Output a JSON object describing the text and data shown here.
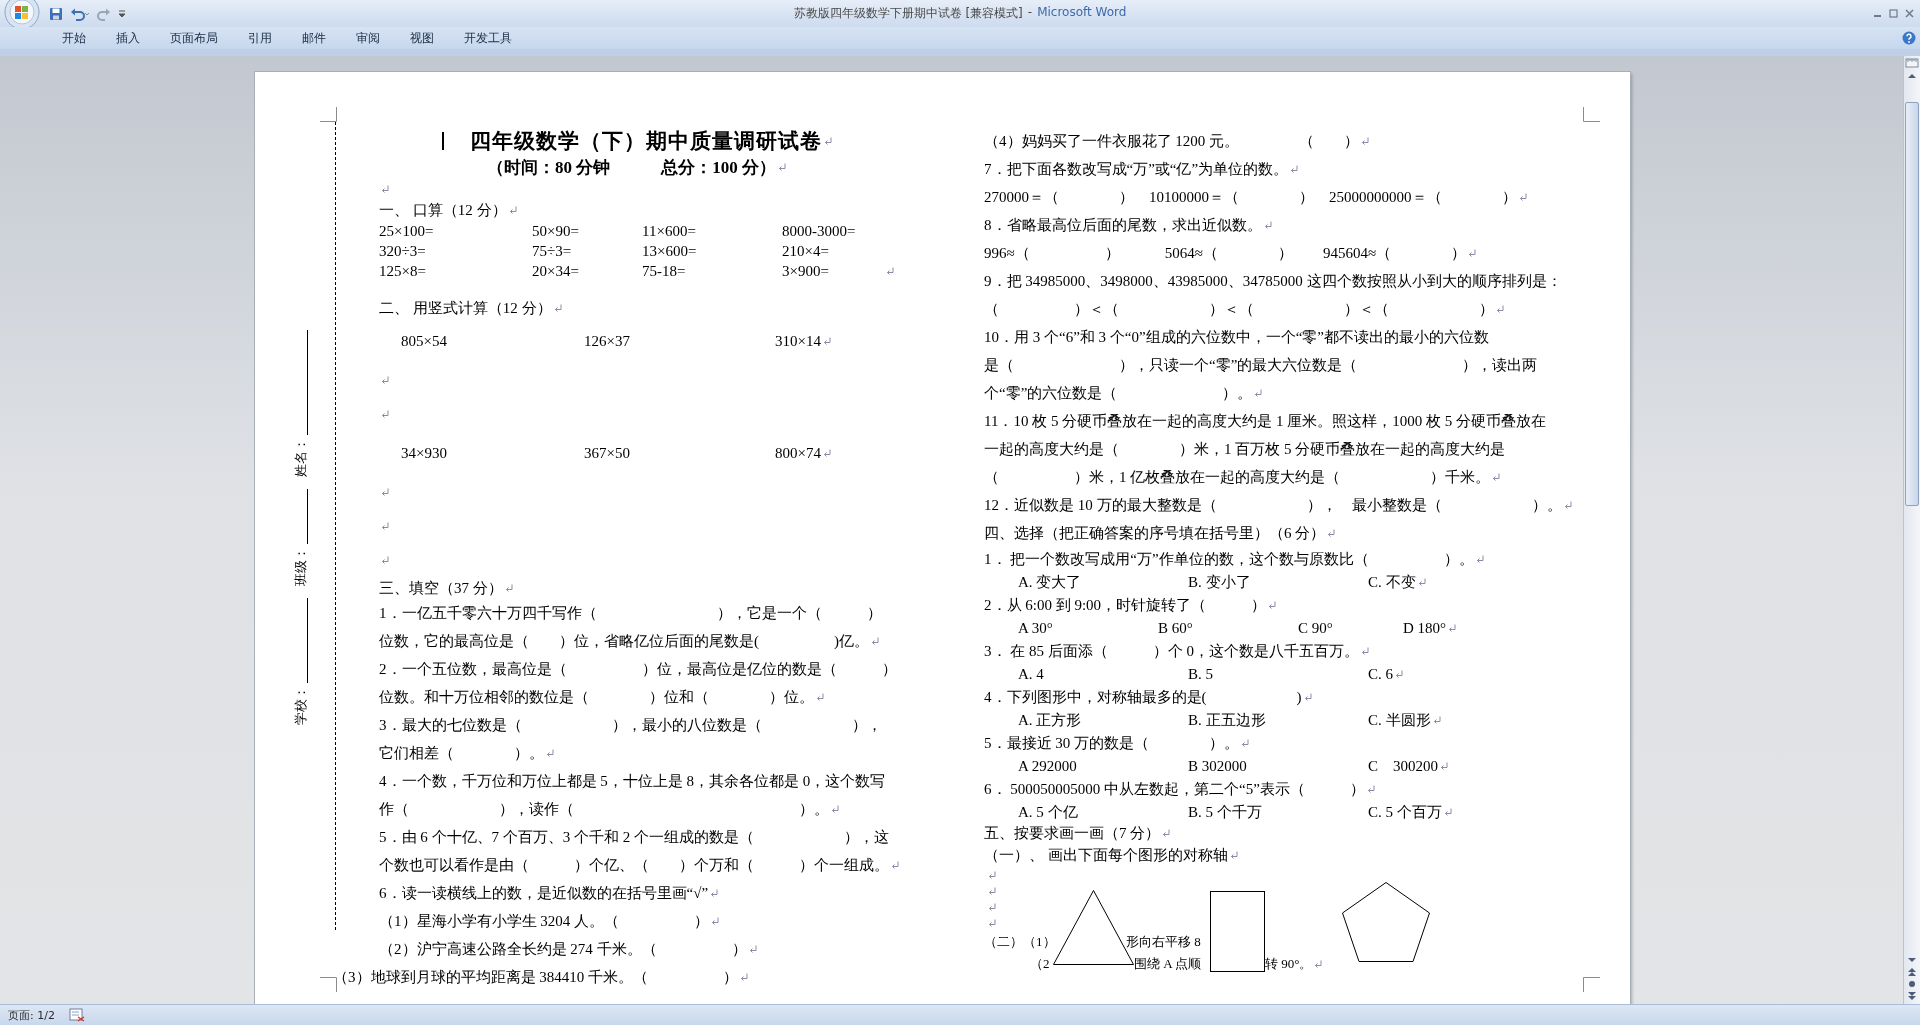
{
  "window": {
    "title": {
      "document": "苏教版四年级数学下册期中试卷 [兼容模式]",
      "separator": "-",
      "app": "Microsoft Word"
    }
  },
  "ribbon": {
    "tabs": [
      {
        "label": "开始",
        "selected": false
      },
      {
        "label": "插入",
        "selected": false
      },
      {
        "label": "页面布局",
        "selected": false
      },
      {
        "label": "引用",
        "selected": false
      },
      {
        "label": "邮件",
        "selected": false
      },
      {
        "label": "审阅",
        "selected": false
      },
      {
        "label": "视图",
        "selected": false
      },
      {
        "label": "开发工具",
        "selected": false
      }
    ]
  },
  "document": {
    "binding_margin": [
      {
        "label": "姓名："
      },
      {
        "label": "班级："
      },
      {
        "label": "学校："
      }
    ],
    "left_column": [
      {
        "kind": "title",
        "text": "四年级数学（下）期中质量调研试卷",
        "end": true
      },
      {
        "kind": "subtitle",
        "text": "（时间：80 分钟　　　总分：100 分）",
        "end": true
      },
      {
        "kind": "blank"
      },
      {
        "kind": "heading",
        "text": "一、 口算（12 分）",
        "end": true
      },
      {
        "kind": "tabs",
        "cells": [
          "25×100=",
          "50×90=",
          "11×600=",
          "8000-3000="
        ],
        "end": false
      },
      {
        "kind": "tabs",
        "cells": [
          "320÷3=",
          "75÷3=",
          "13×600=",
          "210×4="
        ],
        "end": false
      },
      {
        "kind": "tabs",
        "cells": [
          "125×8=",
          "20×34=",
          "75-18=",
          "3×900="
        ],
        "end": true
      },
      {
        "kind": "heading",
        "text": "二、 用竖式计算（12 分）",
        "end": true
      },
      {
        "kind": "calc",
        "cells": [
          "805×54",
          "126×37",
          "310×14"
        ],
        "end": true
      },
      {
        "kind": "blank"
      },
      {
        "kind": "blank"
      },
      {
        "kind": "calc",
        "cells": [
          "34×930",
          "367×50",
          "800×74"
        ],
        "end": true
      },
      {
        "kind": "blank"
      },
      {
        "kind": "blank"
      },
      {
        "kind": "blank"
      },
      {
        "kind": "heading",
        "text": "三、填空（37 分）",
        "end": true
      },
      {
        "kind": "text",
        "text": "1．一亿五千零六十万四千写作（　　　　　　　　），它是一个（　　　）",
        "end": false
      },
      {
        "kind": "text",
        "text": "位数，它的最高位是（　　）位，省略亿位后面的尾数是(　　　　　)亿。",
        "end": true
      },
      {
        "kind": "text",
        "text": "2．一个五位数，最高位是（　　　　　）位，最高位是亿位的数是（　　　）",
        "end": false
      },
      {
        "kind": "text",
        "text": "位数。和十万位相邻的数位是（　　　　）位和（　　　　）位。",
        "end": true
      },
      {
        "kind": "text",
        "text": "3．最大的七位数是（　　　　　　），最小的八位数是（　　　　　　），",
        "end": false
      },
      {
        "kind": "text",
        "text": "它们相差（　　　　）。",
        "end": true
      },
      {
        "kind": "text",
        "text": "4．一个数，千万位和万位上都是 5，十位上是 8，其余各位都是 0，这个数写",
        "end": false
      },
      {
        "kind": "text",
        "text": "作（　　　　　　），读作（　　　　　　　　　　　　　　　）。",
        "end": true
      },
      {
        "kind": "text",
        "text": "5．由 6 个十亿、7 个百万、3 个千和 2 个一组成的数是（　　　　　　），这",
        "end": false
      },
      {
        "kind": "text",
        "text": "个数也可以看作是由（　　　）个亿、（　　）个万和（　　　）个一组成。",
        "end": true
      },
      {
        "kind": "text",
        "text": "6．读一读横线上的数，是近似数的在括号里画“√”",
        "end": true
      },
      {
        "kind": "text",
        "text": "（1）星海小学有小学生 3204 人。（　　　　　）",
        "end": true
      },
      {
        "kind": "text",
        "text": "（2）沪宁高速公路全长约是 274 千米。（　　　　　）",
        "end": true
      },
      {
        "kind": "hanging",
        "text": "（3）地球到月球的平均距离是 384410 千米。（　　　　　）",
        "end": true
      }
    ],
    "right_column": [
      {
        "kind": "text",
        "text": "（4）妈妈买了一件衣服花了 1200 元。　　　　（　　）",
        "end": true
      },
      {
        "kind": "text",
        "text": "7．把下面各数改写成“万”或“亿”为单位的数。",
        "end": true
      },
      {
        "kind": "text",
        "text": "270000＝（　　　　）　10100000＝（　　　　）　25000000000＝（　　　　）",
        "end": true
      },
      {
        "kind": "text",
        "text": "8．省略最高位后面的尾数，求出近似数。",
        "end": true
      },
      {
        "kind": "text",
        "text": "996≈（　　　　　）　　　5064≈（　　　　）　　945604≈（　　　　）",
        "end": true
      },
      {
        "kind": "text",
        "text": "9．把 34985000、3498000、43985000、34785000 这四个数按照从小到大的顺序排列是：",
        "end": false
      },
      {
        "kind": "text",
        "text": "（　　　　　）＜（　　　　　　）＜（　　　　　　）＜（　　　　　　）",
        "end": true
      },
      {
        "kind": "text",
        "text": "10．用 3 个“6”和 3 个“0”组成的六位数中，一个“零”都不读出的最小的六位数",
        "end": false
      },
      {
        "kind": "text",
        "text": "是（　　　　　　　），只读一个“零”的最大六位数是（　　　　　　　），读出两",
        "end": false
      },
      {
        "kind": "text",
        "text": "个“零”的六位数是（　　　　　　　）。",
        "end": true
      },
      {
        "kind": "text",
        "text": "11．10 枚 5 分硬币叠放在一起的高度大约是 1 厘米。照这样，1000 枚 5 分硬币叠放在",
        "end": false
      },
      {
        "kind": "text",
        "text": "一起的高度大约是（　　　　）米，1 百万枚 5 分硬币叠放在一起的高度大约是",
        "end": false
      },
      {
        "kind": "text",
        "text": "（　　　　　）米，1 亿枚叠放在一起的高度大约是（　　　　　　）千米。",
        "end": true
      },
      {
        "kind": "text",
        "text": "12．近似数是 10 万的最大整数是（　　　　　　），　最小整数是（　　　　　　）。",
        "end": true
      },
      {
        "kind": "heading",
        "text": "四、选择（把正确答案的序号填在括号里）（6 分）",
        "end": true
      },
      {
        "kind": "question",
        "text": "1． 把一个数改写成用“万”作单位的数，这个数与原数比（　　　　　）。",
        "end": true
      },
      {
        "kind": "options",
        "cells": [
          "A. 变大了",
          "B. 变小了",
          "C. 不变"
        ],
        "end": true
      },
      {
        "kind": "question",
        "text": "2．从 6:00 到 9:00，时针旋转了（　　　）",
        "end": true
      },
      {
        "kind": "options",
        "cells": [
          "A 30°",
          "B 60°",
          "C 90°",
          "D 180°"
        ],
        "end": true
      },
      {
        "kind": "question",
        "text": "3． 在 85 后面添（　　　）个 0，这个数是八千五百万。",
        "end": true
      },
      {
        "kind": "options",
        "cells": [
          "A. 4",
          "B. 5",
          "C. 6"
        ],
        "end": true
      },
      {
        "kind": "question",
        "text": "4．下列图形中，对称轴最多的是(　　　　　　)",
        "end": true
      },
      {
        "kind": "options",
        "cells": [
          "A. 正方形",
          "B. 正五边形",
          "C. 半圆形"
        ],
        "end": true
      },
      {
        "kind": "question",
        "text": "5．最接近 30 万的数是（　　　　）。",
        "end": true
      },
      {
        "kind": "options",
        "cells": [
          "A 292000",
          "B 302000",
          "C　300200"
        ],
        "end": true
      },
      {
        "kind": "question",
        "text": "6． 500050005000 中从左数起，第二个“5”表示（　　　）",
        "end": true
      },
      {
        "kind": "options",
        "cells": [
          "A. 5 个亿",
          "B. 5 个千万",
          "C. 5 个百万"
        ],
        "end": true
      },
      {
        "kind": "heading",
        "text": "五、按要求画一画（7 分）",
        "end": true
      },
      {
        "kind": "question",
        "text": "（一）、 画出下面每个图形的对称轴",
        "end": true
      },
      {
        "kind": "blank"
      },
      {
        "kind": "blank"
      },
      {
        "kind": "blank"
      },
      {
        "kind": "blank"
      },
      {
        "kind": "fragments",
        "parts": [
          "（二）（1）",
          "形向右平移 8"
        ],
        "end": false
      },
      {
        "kind": "fragments",
        "parts": [
          "（2",
          "围绕 A 点顺",
          "转 90°。"
        ],
        "end": true
      }
    ]
  },
  "status_bar": {
    "page": "页面: 1/2"
  }
}
